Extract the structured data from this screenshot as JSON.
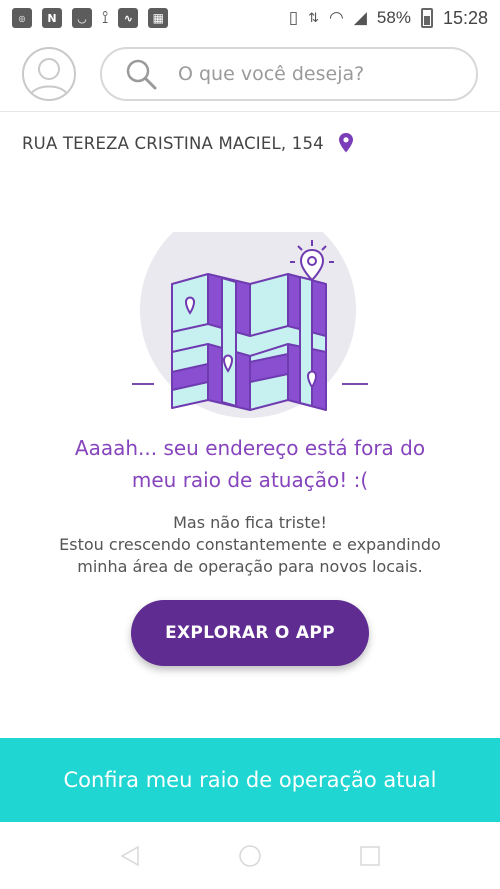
{
  "status_bar": {
    "left_icons": [
      "app-icon-1",
      "nv-icon",
      "bag-icon",
      "signal-app-icon",
      "chart-icon",
      "image-icon"
    ],
    "battery": "58%",
    "time": "15:28"
  },
  "search": {
    "placeholder": "O que você deseja?"
  },
  "address": {
    "text": "RUA TEREZA CRISTINA MACIEL, 154"
  },
  "message": {
    "headline_line1": "Aaaah... seu endereço está fora do",
    "headline_line2": "meu raio de atuação! :(",
    "sub_line1": "Mas não fica triste!",
    "sub_line2": "Estou crescendo constantemente e expandindo",
    "sub_line3": "minha área de operação para novos locais."
  },
  "explore_button": {
    "label": "EXPLORAR O APP"
  },
  "coverage_bar": {
    "label": "Confira meu raio de operação atual"
  },
  "colors": {
    "brand_purple": "#5f2d91",
    "headline_purple": "#8745bd",
    "teal": "#1fd6d2"
  }
}
